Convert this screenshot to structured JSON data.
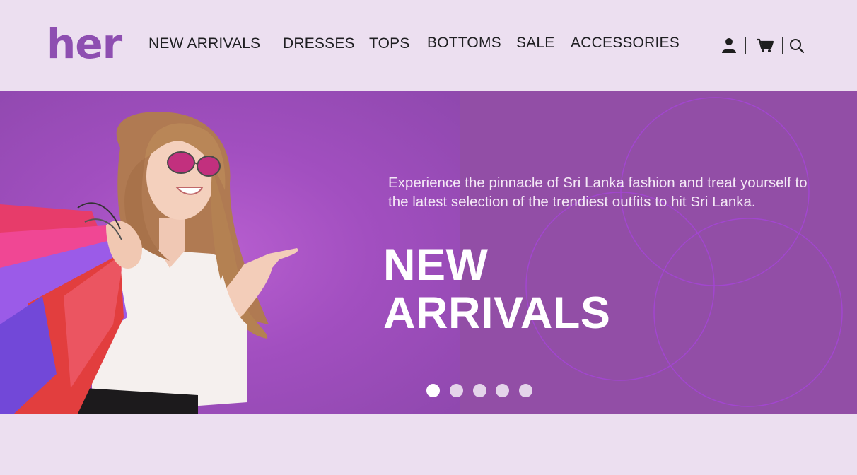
{
  "brand": {
    "logo_text": "her",
    "accent": "#8e4fb1"
  },
  "nav": {
    "items": [
      "NEW ARRIVALS",
      "DRESSES",
      "TOPS",
      "BOTTOMS",
      "SALE",
      "ACCESSORIES"
    ]
  },
  "header_icons": [
    "user-icon",
    "cart-icon",
    "search-icon"
  ],
  "hero": {
    "description": "Experience the pinnacle of Sri Lanka fashion and treat yourself to the  latest selection of the trendiest outfits to hit Sri Lanka.",
    "title_line1": "NEW",
    "title_line2": "ARRIVALS",
    "background": "#924ea6",
    "slides": 5,
    "active_slide": 1
  }
}
